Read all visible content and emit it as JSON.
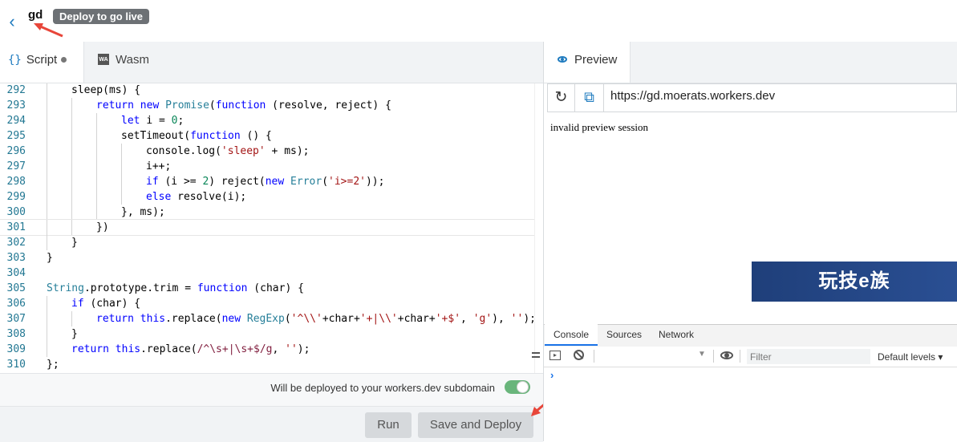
{
  "header": {
    "back_icon": "chevron-left-icon",
    "worker_name": "gd",
    "badge": "Deploy to go live"
  },
  "editor": {
    "tabs": [
      {
        "label": "Script",
        "icon": "braces-icon",
        "modified": true
      },
      {
        "label": "Wasm",
        "icon": "wasm-icon"
      }
    ],
    "icon_text": {
      "braces": "{}",
      "wasm": "WA"
    },
    "lines": [
      {
        "n": "292",
        "tokens": [
          [
            "",
            "sleep(ms) {"
          ]
        ]
      },
      {
        "n": "293",
        "tokens": [
          [
            "kw",
            "return "
          ],
          [
            "kw",
            "new "
          ],
          [
            "ty",
            "Promise"
          ],
          [
            "",
            "("
          ],
          [
            "kw",
            "function"
          ],
          [
            "",
            " (resolve, reject) {"
          ]
        ]
      },
      {
        "n": "294",
        "tokens": [
          [
            "kw",
            "let "
          ],
          [
            "",
            "i = "
          ],
          [
            "num",
            "0"
          ],
          [
            "",
            ";"
          ]
        ]
      },
      {
        "n": "295",
        "tokens": [
          [
            "",
            "setTimeout("
          ],
          [
            "kw",
            "function"
          ],
          [
            "",
            " () {"
          ]
        ]
      },
      {
        "n": "296",
        "tokens": [
          [
            "",
            "console.log("
          ],
          [
            "str",
            "'sleep'"
          ],
          [
            "",
            " + ms);"
          ]
        ]
      },
      {
        "n": "297",
        "tokens": [
          [
            "",
            "i++;"
          ]
        ]
      },
      {
        "n": "298",
        "tokens": [
          [
            "kw",
            "if "
          ],
          [
            "",
            "(i >= "
          ],
          [
            "num",
            "2"
          ],
          [
            "",
            ") reject("
          ],
          [
            "kw",
            "new "
          ],
          [
            "ty",
            "Error"
          ],
          [
            "",
            "("
          ],
          [
            "str",
            "'i>=2'"
          ],
          [
            "",
            "));"
          ]
        ]
      },
      {
        "n": "299",
        "tokens": [
          [
            "kw",
            "else "
          ],
          [
            "",
            "resolve(i);"
          ]
        ]
      },
      {
        "n": "300",
        "tokens": [
          [
            "",
            "}, ms);"
          ]
        ]
      },
      {
        "n": "301",
        "tokens": [
          [
            "",
            "})"
          ]
        ]
      },
      {
        "n": "302",
        "tokens": [
          [
            "",
            "}"
          ]
        ]
      },
      {
        "n": "303",
        "tokens": [
          [
            "",
            "}"
          ]
        ]
      },
      {
        "n": "304",
        "tokens": []
      },
      {
        "n": "305",
        "tokens": [
          [
            "ty",
            "String"
          ],
          [
            "",
            ".prototype.trim = "
          ],
          [
            "kw",
            "function"
          ],
          [
            "",
            " (char) {"
          ]
        ]
      },
      {
        "n": "306",
        "tokens": [
          [
            "kw",
            "if "
          ],
          [
            "",
            "(char) {"
          ]
        ]
      },
      {
        "n": "307",
        "tokens": [
          [
            "kw",
            "return "
          ],
          [
            "kw",
            "this"
          ],
          [
            "",
            ".replace("
          ],
          [
            "kw",
            "new "
          ],
          [
            "ty",
            "RegExp"
          ],
          [
            "",
            "("
          ],
          [
            "str",
            "'^\\\\'"
          ],
          [
            "",
            "+char+"
          ],
          [
            "str",
            "'+|\\\\'"
          ],
          [
            "",
            "+char+"
          ],
          [
            "str",
            "'+$'"
          ],
          [
            "",
            ", "
          ],
          [
            "str",
            "'g'"
          ],
          [
            "",
            "), "
          ],
          [
            "str",
            "''"
          ],
          [
            "",
            ");"
          ]
        ]
      },
      {
        "n": "308",
        "tokens": [
          [
            "",
            "}"
          ]
        ]
      },
      {
        "n": "309",
        "tokens": [
          [
            "kw",
            "return "
          ],
          [
            "kw",
            "this"
          ],
          [
            "",
            ".replace("
          ],
          [
            "rx",
            "/^\\s+|\\s+$/g"
          ],
          [
            "",
            ", "
          ],
          [
            "str",
            "''"
          ],
          [
            "",
            ");"
          ]
        ]
      },
      {
        "n": "310",
        "tokens": [
          [
            "",
            "};"
          ]
        ]
      }
    ]
  },
  "deploy": {
    "note": "Will be deployed to your workers.dev subdomain",
    "toggle_on": true,
    "toggle_color": "#69b57b"
  },
  "actions": {
    "run": "Run",
    "save_deploy": "Save and Deploy"
  },
  "preview": {
    "tab": "Preview",
    "refresh_glyph": "↻",
    "open_glyph": "⧉",
    "url": "https://gd.moerats.workers.dev",
    "message": "invalid preview session",
    "watermark": "玩技e族"
  },
  "devtools": {
    "tabs": [
      "Console",
      "Sources",
      "Network"
    ],
    "sidebar_glyph": "▸",
    "context_arrow": "▼",
    "filter_placeholder": "Filter",
    "levels": "Default levels ▾",
    "prompt": "›"
  },
  "colors": {
    "accent": "#1f7bbf",
    "arrow": "#e8463a"
  }
}
